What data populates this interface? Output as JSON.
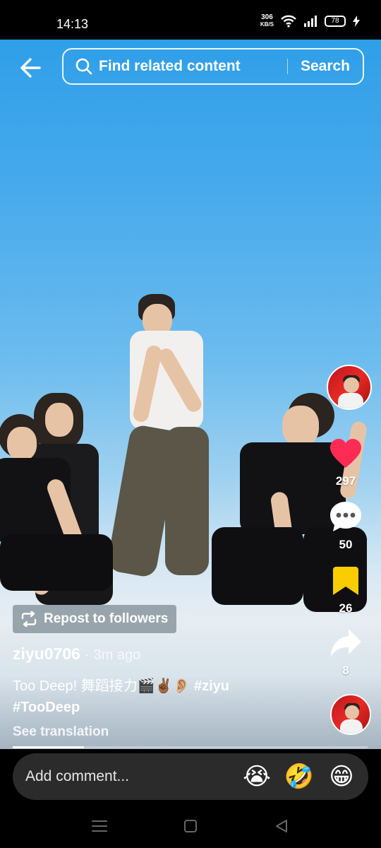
{
  "status_bar": {
    "time": "14:13",
    "network_speed_value": "306",
    "network_speed_unit": "KB/S",
    "battery": "78"
  },
  "search": {
    "placeholder": "Find related content",
    "button": "Search"
  },
  "actions": {
    "likes": "297",
    "comments": "50",
    "saves": "26",
    "shares": "8",
    "like_color": "#fe2c55",
    "save_color": "#facd00"
  },
  "post": {
    "repost_label": "Repost to followers",
    "author": "ziyu0706",
    "separator": "·",
    "time_ago": "3m ago",
    "caption_text": "Too Deep! 舞蹈接力🎬✌🏾👂🏼",
    "hashtag_1": "#ziyu",
    "hashtag_2": "#TooDeep",
    "see_translation": "See translation",
    "progress_fraction": 0.2
  },
  "comment_bar": {
    "placeholder": "Add comment...",
    "emojis": [
      "😭",
      "🤣",
      "😁"
    ]
  },
  "icons": {
    "back": "arrow-left-icon",
    "search": "search-icon",
    "repost": "repost-icon",
    "like": "heart-icon",
    "comment": "comment-bubble-icon",
    "save": "bookmark-icon",
    "share": "share-arrow-icon",
    "nav_recents": "menu-lines-icon",
    "nav_home": "square-icon",
    "nav_back": "triangle-back-icon"
  }
}
